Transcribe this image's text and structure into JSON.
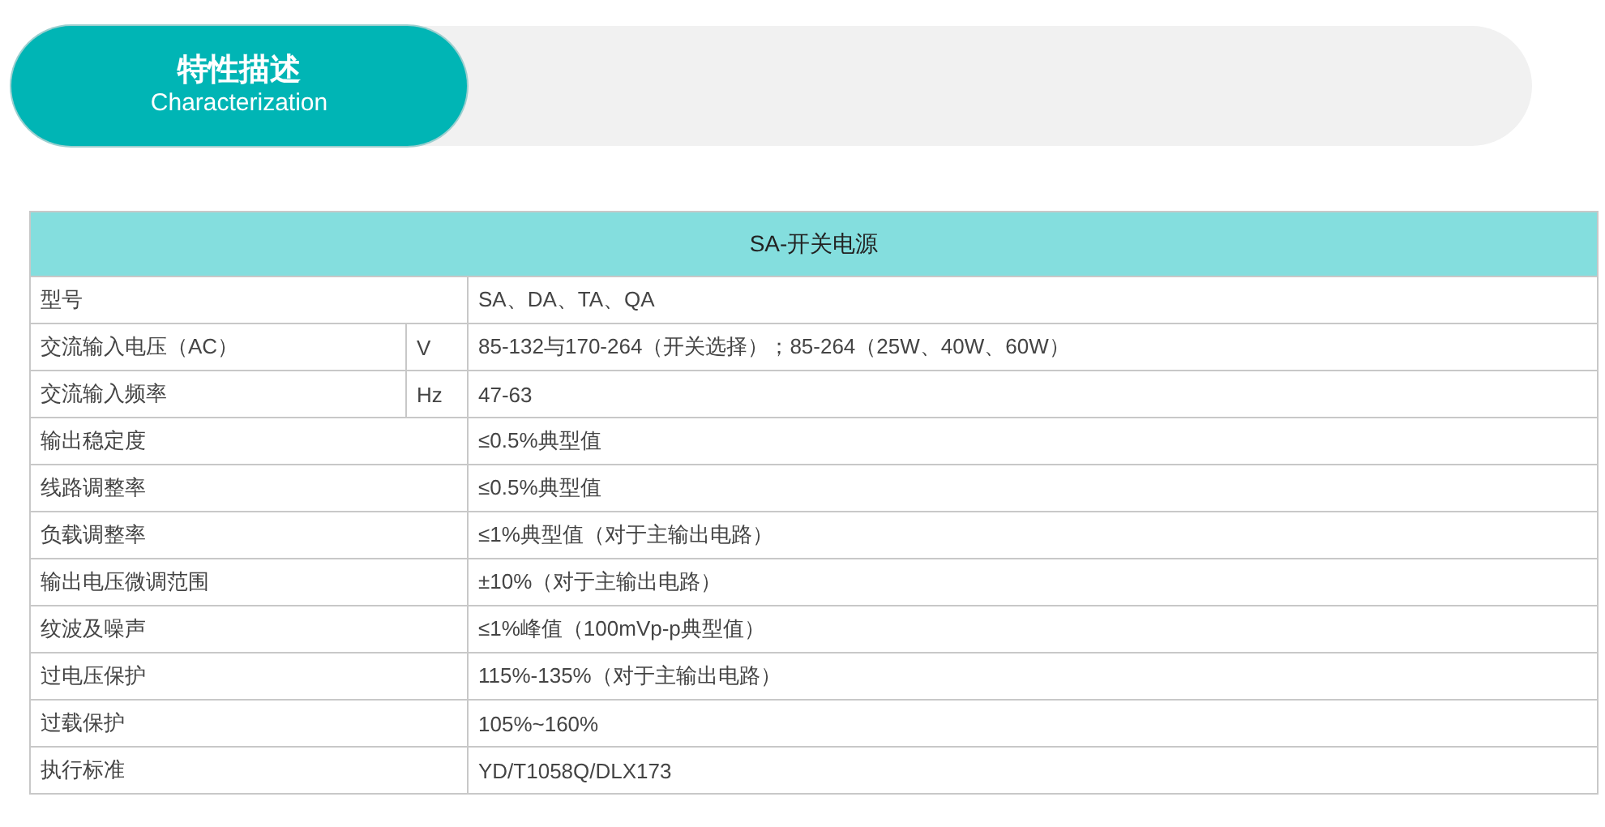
{
  "section_header": {
    "title": "特性描述",
    "subtitle": "Characterization"
  },
  "table": {
    "title": "SA-开关电源",
    "rows": [
      {
        "label": "型号",
        "value": "SA、DA、TA、QA"
      },
      {
        "label": "交流输入电压（AC）",
        "unit": "V",
        "value": "85-132与170-264（开关选择）；85-264（25W、40W、60W）"
      },
      {
        "label": "交流输入频率",
        "unit": "Hz",
        "value": "47-63"
      },
      {
        "label": "输出稳定度",
        "value": "≤0.5%典型值"
      },
      {
        "label": "线路调整率",
        "value": "≤0.5%典型值"
      },
      {
        "label": "负载调整率",
        "value": "≤1%典型值（对于主输出电路）"
      },
      {
        "label": "输出电压微调范围",
        "value": "±10%（对于主输出电路）"
      },
      {
        "label": "纹波及噪声",
        "value": "≤1%峰值（100mVp-p典型值）"
      },
      {
        "label": "过电压保护",
        "value": "115%-135%（对于主输出电路）"
      },
      {
        "label": "过载保护",
        "value": "105%~160%"
      },
      {
        "label": "执行标准",
        "value": "YD/T1058Q/DLX173"
      }
    ]
  }
}
